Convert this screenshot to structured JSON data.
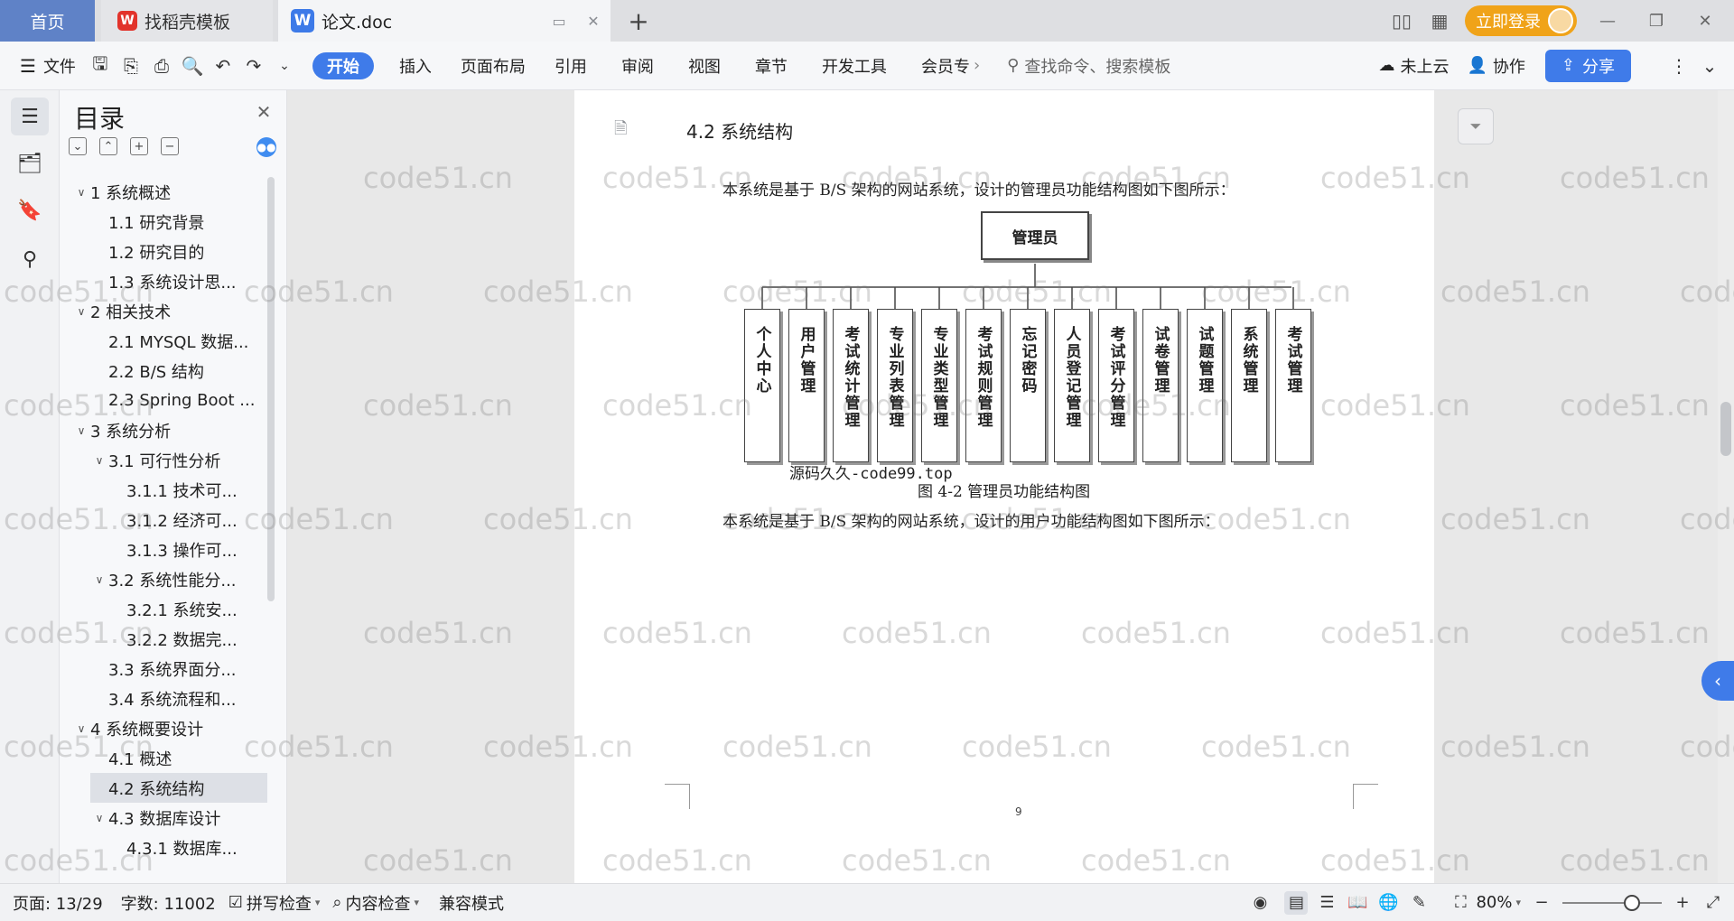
{
  "titlebar": {
    "tabs": [
      {
        "label": "首页"
      },
      {
        "label": "找稻壳模板"
      },
      {
        "label": "论文.doc"
      }
    ],
    "login_label": "立即登录",
    "new_tab": "+"
  },
  "ribbon": {
    "file_label": "文件",
    "tabs": [
      "开始",
      "插入",
      "页面布局",
      "引用",
      "审阅",
      "视图",
      "章节",
      "开发工具",
      "会员专"
    ],
    "search_placeholder": "查找命令、搜索模板",
    "cloud_label": "未上云",
    "collab_label": "协作",
    "share_label": "分享"
  },
  "toc": {
    "title": "目录",
    "items": [
      {
        "label": "1 系统概述",
        "level": 1,
        "expanded": true
      },
      {
        "label": "1.1  研究背景",
        "level": 2
      },
      {
        "label": "1.2 研究目的",
        "level": 2
      },
      {
        "label": "1.3 系统设计思...",
        "level": 2
      },
      {
        "label": "2 相关技术",
        "level": 1,
        "expanded": true
      },
      {
        "label": "2.1 MYSQL 数据...",
        "level": 2
      },
      {
        "label": "2.2 B/S 结构",
        "level": 2
      },
      {
        "label": "2.3 Spring Boot ...",
        "level": 2
      },
      {
        "label": "3 系统分析",
        "level": 1,
        "expanded": true
      },
      {
        "label": "3.1 可行性分析",
        "level": 2,
        "expanded": true
      },
      {
        "label": "3.1.1 技术可...",
        "level": 3
      },
      {
        "label": "3.1.2 经济可...",
        "level": 3
      },
      {
        "label": "3.1.3 操作可...",
        "level": 3
      },
      {
        "label": "3.2 系统性能分...",
        "level": 2,
        "expanded": true
      },
      {
        "label": "3.2.1  系统安...",
        "level": 3
      },
      {
        "label": "3.2.2  数据完...",
        "level": 3
      },
      {
        "label": "3.3 系统界面分...",
        "level": 2
      },
      {
        "label": "3.4 系统流程和...",
        "level": 2
      },
      {
        "label": "4 系统概要设计",
        "level": 1,
        "expanded": true
      },
      {
        "label": "4.1 概述",
        "level": 2
      },
      {
        "label": "4.2 系统结构",
        "level": 2,
        "selected": true
      },
      {
        "label": "4.3 数据库设计",
        "level": 2,
        "expanded": true
      },
      {
        "label": "4.3.1 数据库...",
        "level": 3
      }
    ]
  },
  "document": {
    "heading": "4.2 系统结构",
    "para1": "本系统是基于 B/S 架构的网站系统，设计的管理员功能结构图如下图所示：",
    "para2": "本系统是基于 B/S 架构的网站系统，设计的用户功能结构图如下图所示：",
    "caption": "图 4-2 管理员功能结构图",
    "source_note": "源码久久-code99.top",
    "page_number": "9",
    "diagram": {
      "root": "管理员",
      "children": [
        "个人中心",
        "用户管理",
        "考试统计管理",
        "专业列表管理",
        "专业类型管理",
        "考试规则管理",
        "忘记密码",
        "人员登记管理",
        "考试评分管理",
        "试卷管理",
        "试题管理",
        "系统管理",
        "考试管理"
      ]
    },
    "watermark": "code51.cn"
  },
  "statusbar": {
    "page": "页面: 13/29",
    "words": "字数: 11002",
    "spell": "拼写检查",
    "content_check": "内容检查",
    "compat": "兼容模式",
    "zoom": "80%"
  },
  "colors": {
    "accent": "#3f7be9",
    "home_tab": "#5f82c7",
    "login": "#f0a319"
  }
}
